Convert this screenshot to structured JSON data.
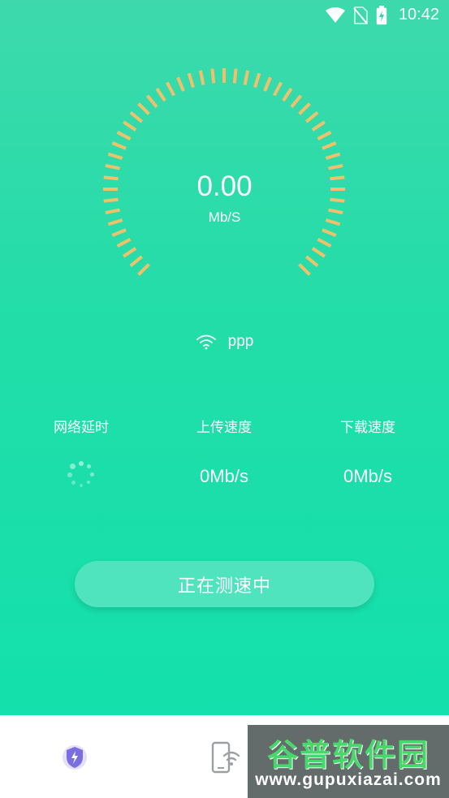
{
  "status_bar": {
    "time": "10:42",
    "icons": [
      "wifi-icon",
      "no-sim-icon",
      "battery-charging-icon"
    ]
  },
  "gauge": {
    "value": "0.00",
    "unit": "Mb/S",
    "level": 0,
    "accent_color": "#f0c16a"
  },
  "network": {
    "icon": "wifi-icon",
    "name": "ppp"
  },
  "stats": {
    "latency_label": "网络延时",
    "upload_label": "上传速度",
    "upload_value": "0Mb/s",
    "download_label": "下载速度",
    "download_value": "0Mb/s"
  },
  "action": {
    "button_label": "正在测速中"
  },
  "bottom_nav": {
    "items": [
      {
        "icon": "shield-lightning-icon"
      },
      {
        "icon": "phone-wifi-icon"
      }
    ]
  },
  "watermark": {
    "title": "谷普软件园",
    "url": "www.gupuxiazai.com"
  },
  "colors": {
    "background_top": "#3dd9ac",
    "background_bottom": "#13e0ac",
    "gauge_ticks": "#f0c16a",
    "button_bg": "#4fe4bd",
    "nav_icon_purple": "#7b6fe0"
  }
}
